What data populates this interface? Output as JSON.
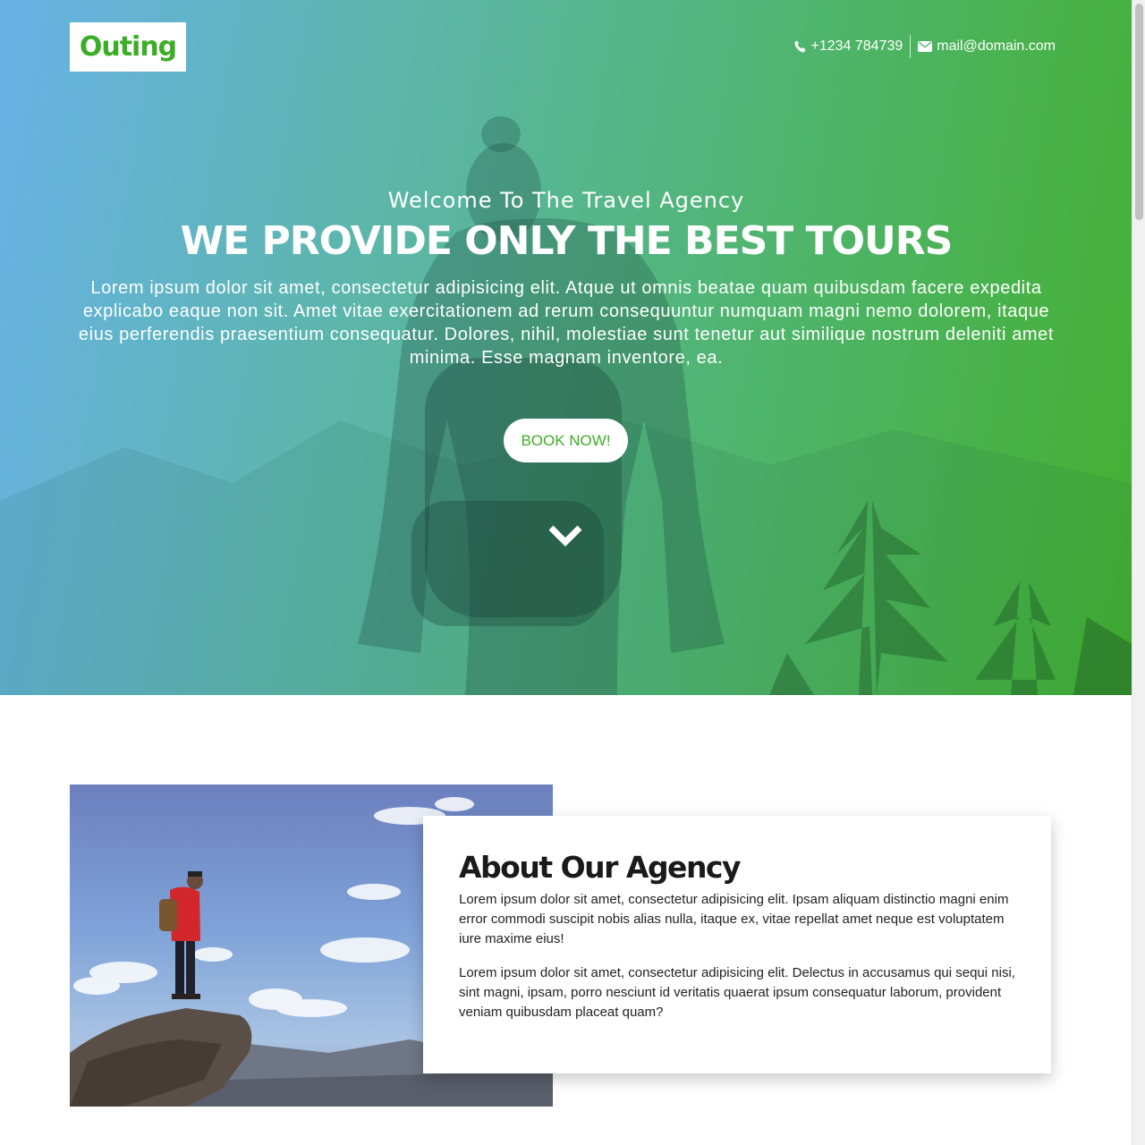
{
  "header": {
    "logo_text": "Outing",
    "phone": "+1234 784739",
    "email": "mail@domain.com",
    "phone_icon": "phone-icon",
    "email_icon": "envelope-icon"
  },
  "hero": {
    "welcome": "Welcome To The Travel Agency",
    "headline": "WE PROVIDE ONLY THE BEST TOURS",
    "lead": "Lorem ipsum dolor sit amet, consectetur adipisicing elit. Atque ut omnis beatae quam quibusdam facere expedita explicabo eaque non sit. Amet vitae exercitationem ad rerum consequuntur numquam magni nemo dolorem, itaque eius perferendis praesentium consequatur. Dolores, nihil, molestiae sunt tenetur aut similique nostrum deleniti amet minima. Esse magnam inventore, ea.",
    "cta_label": "BOOK NOW!",
    "scroll_icon": "chevron-down-icon"
  },
  "about": {
    "title": "About Our Agency",
    "paragraph_1": "Lorem ipsum dolor sit amet, consectetur adipisicing elit. Ipsam aliquam distinctio magni enim error commodi suscipit nobis alias nulla, itaque ex, vitae repellat amet neque est voluptatem iure maxime eius!",
    "paragraph_2": "Lorem ipsum dolor sit amet, consectetur adipisicing elit. Delectus in accusamus qui sequi nisi, sint magni, ipsam, porro nesciunt id veritatis quaerat ipsum consequatur laborum, provident veniam quibusdam placeat quam?"
  },
  "colors": {
    "brand_green": "#3cad27",
    "gradient_start": "#67b2e6",
    "gradient_end": "#43b02f"
  }
}
